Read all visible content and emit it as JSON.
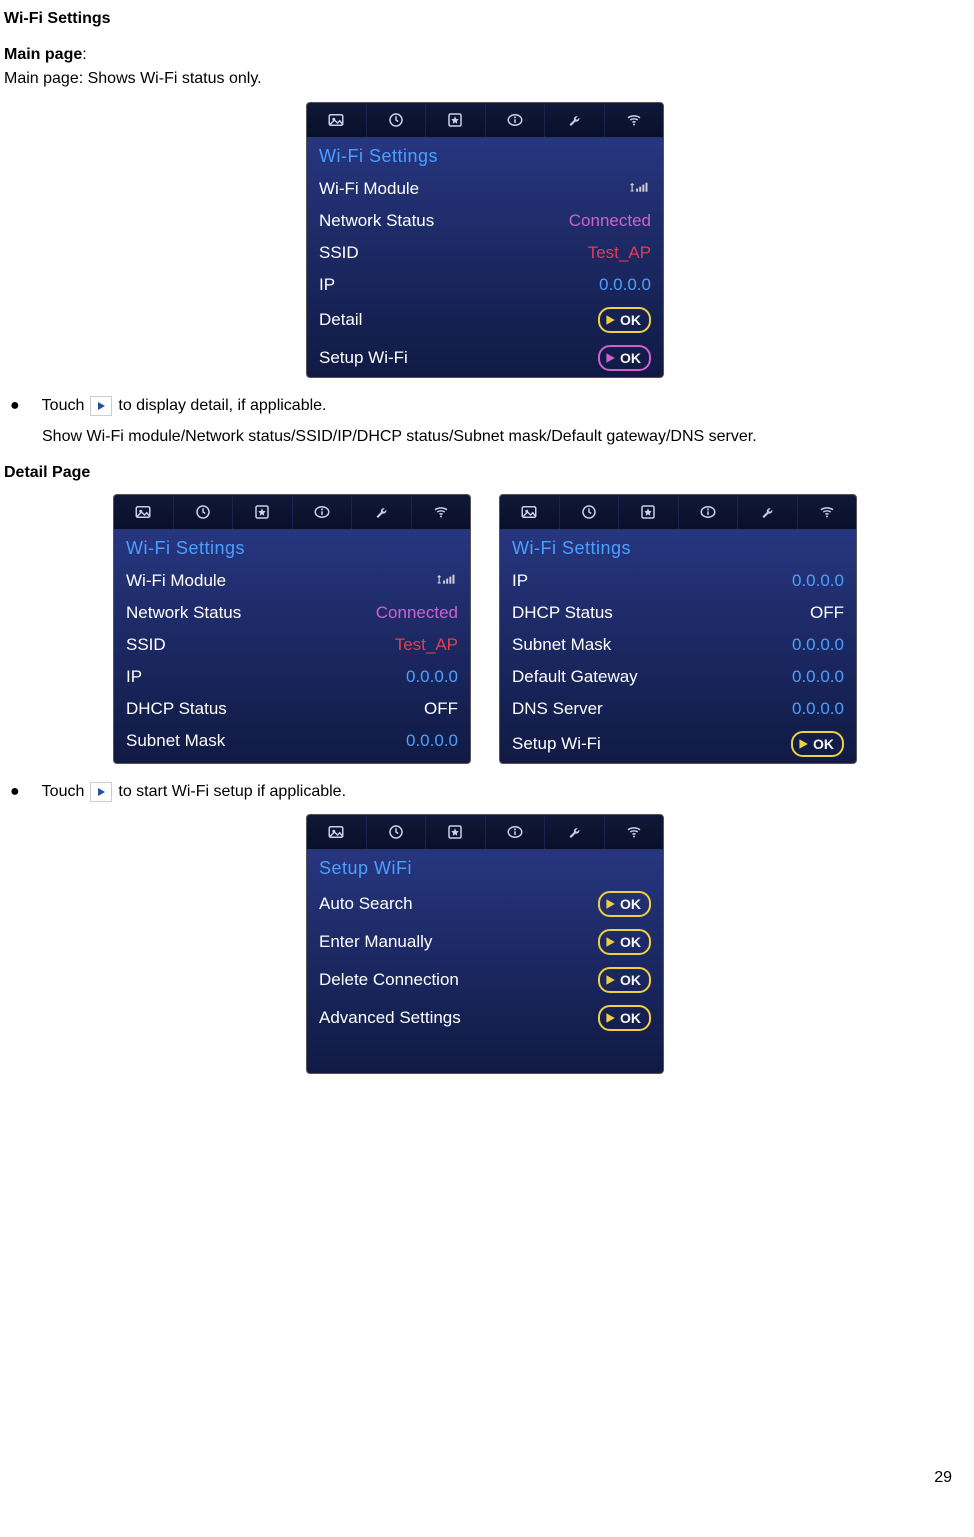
{
  "headings": {
    "title": "Wi-Fi Settings",
    "main_page_label": "Main page",
    "colon": ":",
    "main_page_desc": "Main page: Shows Wi-Fi status only.",
    "detail_page_label": "Detail Page"
  },
  "bullets": {
    "touch_prefix": "Touch",
    "detail_suffix": "to display detail, if applicable.",
    "detail_explain": "Show Wi-Fi module/Network status/SSID/IP/DHCP status/Subnet mask/Default gateway/DNS server.",
    "setup_suffix": "to start Wi-Fi setup if applicable."
  },
  "screens": {
    "main": {
      "section": "Wi-Fi  Settings",
      "rows": [
        {
          "label": "Wi-Fi Module",
          "value": "signal",
          "type": "signal"
        },
        {
          "label": "Network Status",
          "value": "Connected",
          "type": "magenta"
        },
        {
          "label": "SSID",
          "value": "Test_AP",
          "type": "red"
        },
        {
          "label": "IP",
          "value": "0.0.0.0",
          "type": "blue"
        },
        {
          "label": "Detail",
          "value": "OK",
          "type": "ok"
        },
        {
          "label": "Setup Wi-Fi",
          "value": "OK",
          "type": "ok-magenta"
        }
      ]
    },
    "detail_left": {
      "section": "Wi-Fi  Settings",
      "rows": [
        {
          "label": "Wi-Fi Module",
          "value": "signal",
          "type": "signal"
        },
        {
          "label": "Network Status",
          "value": "Connected",
          "type": "magenta"
        },
        {
          "label": "SSID",
          "value": "Test_AP",
          "type": "red"
        },
        {
          "label": "IP",
          "value": "0.0.0.0",
          "type": "blue"
        },
        {
          "label": "DHCP Status",
          "value": "OFF",
          "type": "white"
        },
        {
          "label": "Subnet Mask",
          "value": "0.0.0.0",
          "type": "blue"
        }
      ]
    },
    "detail_right": {
      "section": "Wi-Fi  Settings",
      "rows": [
        {
          "label": "IP",
          "value": "0.0.0.0",
          "type": "blue"
        },
        {
          "label": "DHCP Status",
          "value": "OFF",
          "type": "white"
        },
        {
          "label": "Subnet Mask",
          "value": "0.0.0.0",
          "type": "blue"
        },
        {
          "label": "Default Gateway",
          "value": "0.0.0.0",
          "type": "blue"
        },
        {
          "label": "DNS Server",
          "value": "0.0.0.0",
          "type": "blue"
        },
        {
          "label": "Setup Wi-Fi",
          "value": "OK",
          "type": "ok"
        }
      ]
    },
    "setup": {
      "section": "Setup WiFi",
      "rows": [
        {
          "label": "Auto Search",
          "value": "OK",
          "type": "ok"
        },
        {
          "label": "Enter Manually",
          "value": "OK",
          "type": "ok"
        },
        {
          "label": "Delete Connection",
          "value": "OK",
          "type": "ok"
        },
        {
          "label": "Advanced Settings",
          "value": "OK",
          "type": "ok"
        }
      ]
    }
  },
  "page_number": "29"
}
